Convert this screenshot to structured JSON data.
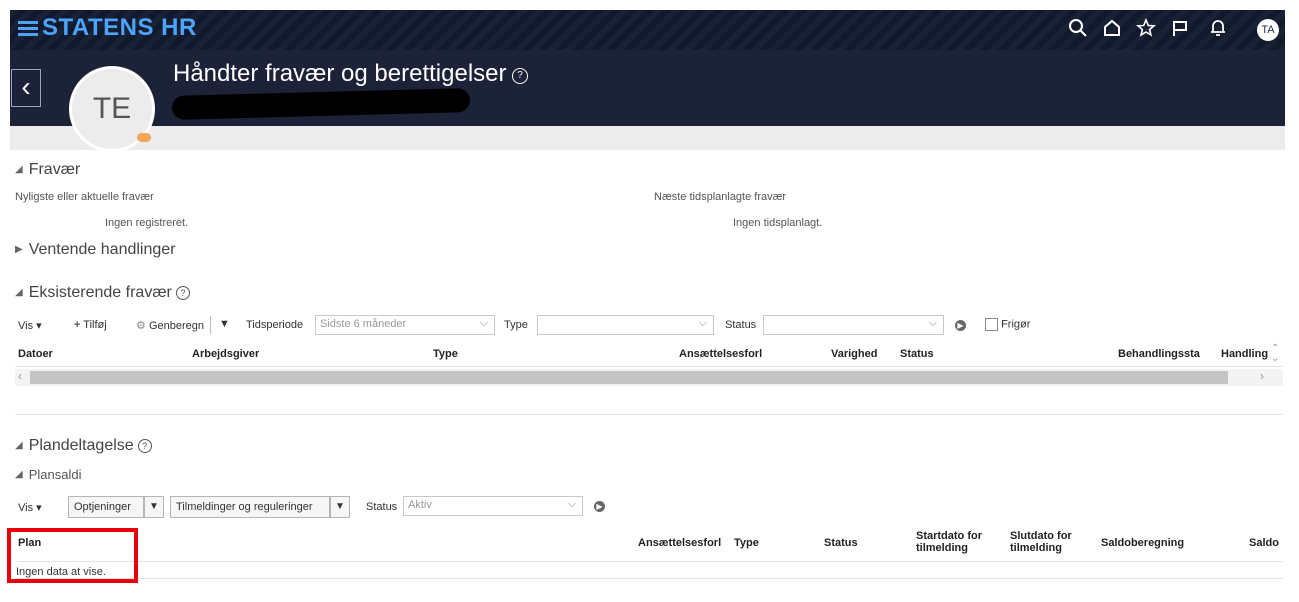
{
  "app": {
    "brand": "STATENS HR",
    "user_initials": "TA"
  },
  "header": {
    "title": "Håndter fravær og berettigelser",
    "avatar_initials": "TE",
    "help": "?"
  },
  "top_icons": [
    "search-icon",
    "home-icon",
    "star-icon",
    "flag-icon",
    "bell-icon"
  ],
  "fravaer": {
    "title": "Fravær",
    "recent_label": "Nyligste eller aktuelle fravær",
    "recent_value": "Ingen registreret.",
    "next_label": "Næste tidsplanlagte fravær",
    "next_value": "Ingen tidsplanlagt."
  },
  "pending": {
    "title": "Ventende handlinger"
  },
  "existing": {
    "title": "Eksisterende fravær",
    "toolbar": {
      "vis": "Vis",
      "add": "Tilføj",
      "recalc": "Genberegn",
      "period_label": "Tidsperiode",
      "period_value": "Sidste 6 måneder",
      "type_label": "Type",
      "type_value": "",
      "status_label": "Status",
      "status_value": "",
      "release": "Frigør"
    },
    "columns": [
      "Datoer",
      "Arbejdsgiver",
      "Type",
      "Ansættelsesforl",
      "Varighed",
      "Status",
      "Behandlingssta",
      "Handling"
    ]
  },
  "plan_section": {
    "title": "Plandeltagelse",
    "subtitle": "Plansaldi",
    "toolbar": {
      "vis": "Vis",
      "accruals": "Optjeninger",
      "enrollments": "Tilmeldinger og reguleringer",
      "status_label": "Status",
      "status_value": "Aktiv"
    },
    "columns": [
      "Plan",
      "Ansættelsesforl",
      "Type",
      "Status",
      "Startdato for tilmelding",
      "Slutdato for tilmelding",
      "Saldoberegning",
      "Saldo"
    ],
    "empty": "Ingen data at vise."
  },
  "highlight_color": "#e8000b",
  "accent_color": "#4da3ff"
}
